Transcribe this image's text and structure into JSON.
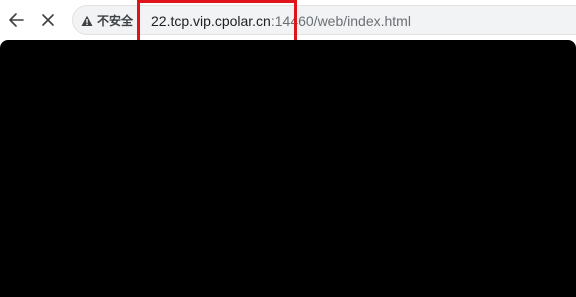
{
  "toolbar": {
    "back_icon": "arrow-left-icon",
    "stop_icon": "close-icon",
    "security_icon": "warning-triangle-icon",
    "security_label": "不安全",
    "url_host": "22.tcp.vip.cpolar.cn",
    "url_rest": ":14460/web/index.html"
  },
  "annotation": {
    "highlight_color": "#e0151b"
  },
  "viewport": {
    "background": "#000000"
  }
}
